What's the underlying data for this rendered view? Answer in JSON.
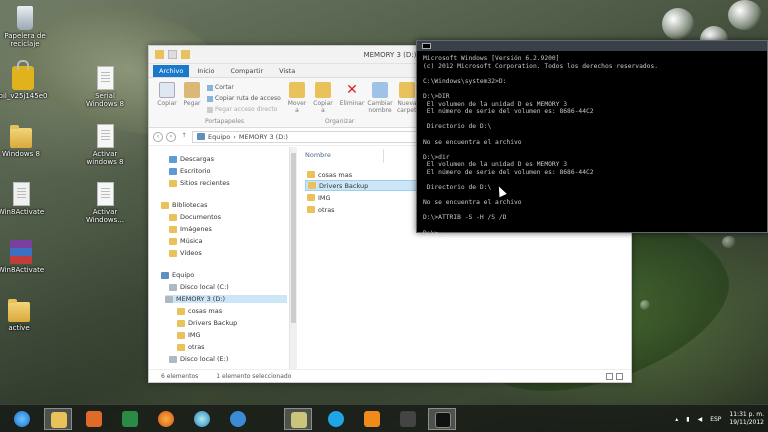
{
  "desktop": {
    "icons": [
      {
        "label": "Papelera de reciclaje",
        "kind": "recycle-bin"
      },
      {
        "label": "pil_v25j145e0",
        "kind": "lock"
      },
      {
        "label": "Serial Windows 8",
        "kind": "document"
      },
      {
        "label": "Windows 8",
        "kind": "folder"
      },
      {
        "label": "Activar windows 8",
        "kind": "document"
      },
      {
        "label": "Win8Activate",
        "kind": "activator"
      },
      {
        "label": "Activar Windows...",
        "kind": "document"
      },
      {
        "label": "Win8Activate",
        "kind": "rar"
      },
      {
        "label": "active",
        "kind": "folder"
      }
    ]
  },
  "explorer": {
    "title": "MEMORY 3 (D:)",
    "tabs": [
      "Archivo",
      "Inicio",
      "Compartir",
      "Vista"
    ],
    "ribbon": {
      "copy": "Copiar",
      "paste": "Pegar",
      "cut": "Cortar",
      "copy_path": "Copiar ruta de acceso",
      "paste_shortcut": "Pegar acceso directo",
      "move_to": "Mover a",
      "copy_to": "Copiar a",
      "delete": "Eliminar",
      "rename": "Cambiar nombre",
      "new_folder": "Nueva carpeta",
      "group_clipboard": "Portapapeles",
      "group_organize": "Organizar"
    },
    "address": {
      "part1": "Equipo",
      "part2": "MEMORY 3 (D:)"
    },
    "nav": {
      "favorites": [
        "Descargas",
        "Escritorio",
        "Sitios recientes"
      ],
      "libraries_title": "Bibliotecas",
      "libraries": [
        "Documentos",
        "Imágenes",
        "Música",
        "Vídeos"
      ],
      "computer_title": "Equipo",
      "drives": [
        "Disco local (C:)",
        "MEMORY 3 (D:)"
      ],
      "drive_children": [
        "cosas mas",
        "Drivers Backup",
        "IMG",
        "otras"
      ],
      "extra_drive": "Disco local (E:)"
    },
    "column_header": "Nombre",
    "files": [
      "cosas mas",
      "Drivers Backup",
      "IMG",
      "otras"
    ],
    "selected_file": "Drivers Backup",
    "status": {
      "count": "6 elementos",
      "selected": "1 elemento seleccionado"
    }
  },
  "cmd": {
    "lines": [
      "Microsoft Windows [Versión 6.2.9200]",
      "(c) 2012 Microsoft Corporation. Todos los derechos reservados.",
      "",
      "C:\\Windows\\system32>D:",
      "",
      "D:\\>DIR",
      " El volumen de la unidad D es MEMORY 3",
      " El número de serie del volumen es: 8686-44C2",
      "",
      " Directorio de D:\\",
      "",
      "No se encuentra el archivo",
      "",
      "D:\\>dir",
      " El volumen de la unidad D es MEMORY 3",
      " El número de serie del volumen es: 8686-44C2",
      "",
      " Directorio de D:\\",
      "",
      "No se encuentra el archivo",
      "",
      "D:\\>ATTRIB -S -H /S /D",
      "",
      "D:\\>_"
    ]
  },
  "taskbar": {
    "apps": [
      "internet-explorer",
      "file-explorer",
      "media-player",
      "excel",
      "firefox",
      "app-circle",
      "app-q",
      "notes",
      "skype",
      "vlc",
      "app-dark",
      "cmd"
    ],
    "language": "ESP",
    "time": "11:31 p. m.",
    "date": "19/11/2012"
  }
}
